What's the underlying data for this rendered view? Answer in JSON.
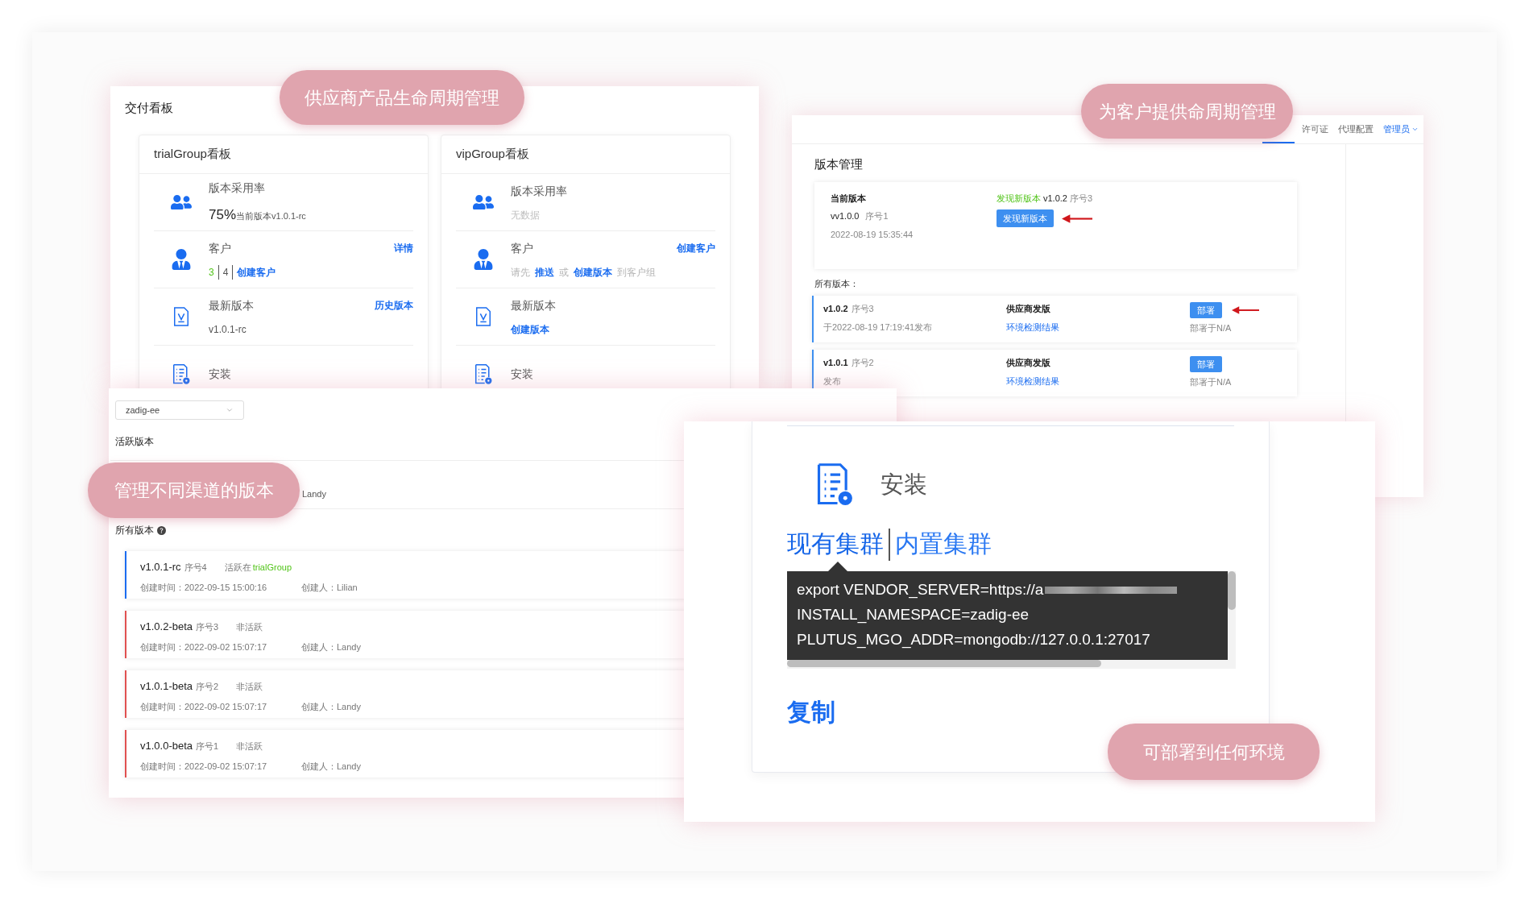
{
  "delivery_board": {
    "title": "交付看板",
    "boards": [
      {
        "title": "trialGroup看板",
        "rows": [
          {
            "kind": "adoption",
            "label": "版本采用率",
            "percent": "75%",
            "note": "当前版本v1.0.1-rc"
          },
          {
            "kind": "customers",
            "label": "客户",
            "action": "详情",
            "parts": [
              {
                "text": "3",
                "kind": "green",
                "divider": true
              },
              {
                "text": "4",
                "kind": "dark",
                "divider": true
              },
              {
                "text": "创建客户",
                "kind": "link",
                "divider": false
              }
            ]
          },
          {
            "kind": "latest",
            "label": "最新版本",
            "action": "历史版本",
            "value": "v1.0.1-rc"
          },
          {
            "kind": "install",
            "label": "安装"
          }
        ]
      },
      {
        "title": "vipGroup看板",
        "rows": [
          {
            "kind": "adoption",
            "label": "版本采用率",
            "note": "无数据"
          },
          {
            "kind": "customers",
            "label": "客户",
            "action": "创建客户",
            "parts": [
              {
                "text": "请先",
                "kind": "muted",
                "divider": false
              },
              {
                "text": "推送",
                "kind": "link",
                "divider": false
              },
              {
                "text": "或",
                "kind": "muted",
                "divider": false
              },
              {
                "text": "创建版本",
                "kind": "link",
                "divider": false
              },
              {
                "text": "到客户组",
                "kind": "muted",
                "divider": false
              }
            ]
          },
          {
            "kind": "latest",
            "label": "最新版本",
            "link": "创建版本"
          },
          {
            "kind": "install",
            "label": "安装"
          }
        ]
      }
    ]
  },
  "version_management": {
    "nav": [
      {
        "label": "许可证",
        "kind": "tab"
      },
      {
        "label": "代理配置",
        "kind": "tab"
      },
      {
        "label": "管理员",
        "kind": "user-menu"
      }
    ],
    "title": "版本管理",
    "current": {
      "heading": "当前版本",
      "version": "vv1.0.0",
      "seq": "序号1",
      "date": "2022-08-19 15:35:44",
      "notice": "发现新版本",
      "new_version": "v1.0.2",
      "new_seq": "序号3",
      "button": "发现新版本",
      "arrow": true
    },
    "all_label": "所有版本：",
    "rows": [
      {
        "version": "v1.0.2",
        "seq": "序号3",
        "published": "于2022-08-19 17:19:41发布",
        "source": "供应商发版",
        "link": "环境检测结果",
        "button": "部署",
        "deployed": "部署于N/A",
        "arrow": true
      },
      {
        "version": "v1.0.1",
        "seq": "序号2",
        "published": "发布",
        "source": "供应商发版",
        "link": "环境检测结果",
        "button": "部署",
        "deployed": "部署于N/A",
        "arrow": false
      }
    ]
  },
  "channel_versions": {
    "select": "zadig-ee",
    "active_label": "活跃版本",
    "active_rows": [
      {
        "creator": "Landy"
      }
    ],
    "all_label": "所有版本",
    "versions": [
      {
        "version": "v1.0.1-rc",
        "seq": "序号4",
        "status": "活跃在",
        "group": "trialGroup",
        "active": true,
        "created": "创建时间：2022-09-15 15:00:16",
        "creator": "创建人：Lilian"
      },
      {
        "version": "v1.0.2-beta",
        "seq": "序号3",
        "status": "非活跃",
        "active": false,
        "created": "创建时间：2022-09-02 15:07:17",
        "creator": "创建人：Landy"
      },
      {
        "version": "v1.0.1-beta",
        "seq": "序号2",
        "status": "非活跃",
        "active": false,
        "created": "创建时间：2022-09-02 15:07:17",
        "creator": "创建人：Landy"
      },
      {
        "version": "v1.0.0-beta",
        "seq": "序号1",
        "status": "非活跃",
        "active": false,
        "created": "创建时间：2022-09-02 15:07:17",
        "creator": "创建人：Landy"
      }
    ]
  },
  "install": {
    "title": "安装",
    "tabs": [
      {
        "label": "现有集群",
        "selected": true
      },
      {
        "label": "内置集群",
        "selected": false
      }
    ],
    "code": [
      "export VENDOR_SERVER=https://a",
      "INSTALL_NAMESPACE=zadig-ee",
      "PLUTUS_MGO_ADDR=mongodb://127.0.0.1:27017"
    ],
    "redacted": true,
    "copy": "复制"
  },
  "callouts": [
    "供应商产品生命周期管理",
    "为客户提供命周期管理",
    "管理不同渠道的版本",
    "可部署到任何环境"
  ]
}
